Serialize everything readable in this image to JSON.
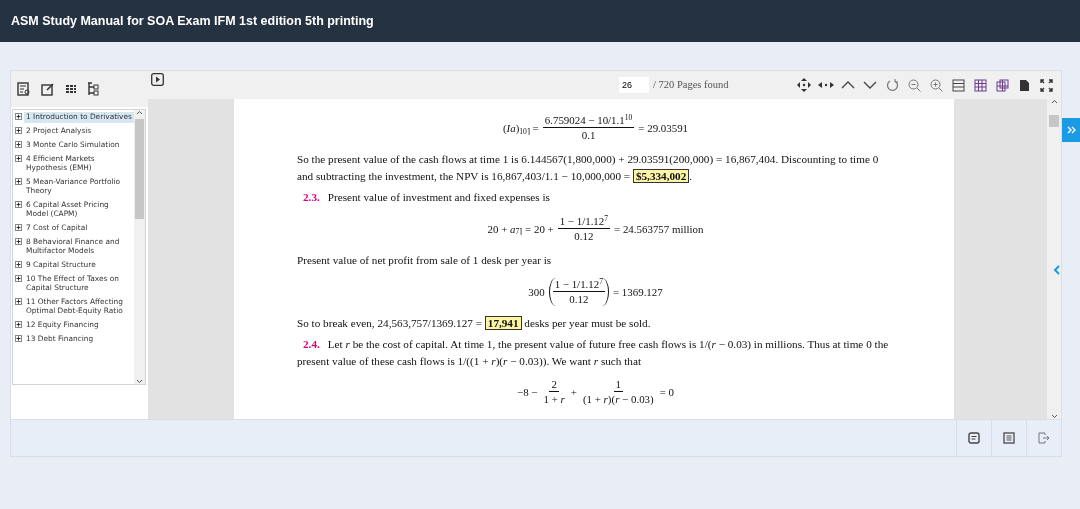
{
  "header": {
    "title": "ASM Study Manual for SOA Exam IFM 1st edition 5th printing"
  },
  "toc": {
    "items": [
      {
        "label": "1 Introduction to Derivatives",
        "selected": true
      },
      {
        "label": "2 Project Analysis",
        "selected": false
      },
      {
        "label": "3 Monte Carlo Simulation",
        "selected": false
      },
      {
        "label": "4 Efficient Markets Hypothesis (EMH)",
        "selected": false
      },
      {
        "label": "5 Mean-Variance Portfolio Theory",
        "selected": false
      },
      {
        "label": "6 Capital Asset Pricing Model (CAPM)",
        "selected": false
      },
      {
        "label": "7 Cost of Capital",
        "selected": false
      },
      {
        "label": "8 Behavioral Finance and Multifactor Models",
        "selected": false
      },
      {
        "label": "9 Capital Structure",
        "selected": false
      },
      {
        "label": "10 The Effect of Taxes on Capital Structure",
        "selected": false
      },
      {
        "label": "11 Other Factors Affecting Optimal Debt-Equity Ratio",
        "selected": false
      },
      {
        "label": "12 Equity Financing",
        "selected": false
      },
      {
        "label": "13 Debt Financing",
        "selected": false
      }
    ]
  },
  "viewer": {
    "page": "26",
    "page_count": "/ 720 Pages found"
  },
  "document": {
    "blocks": [
      {
        "kind": "equation",
        "terms": [
          {
            "kind": "text",
            "text": "(*Ia*)$_{10⌉}$ ="
          },
          {
            "kind": "frac",
            "num": "6.759024 − 10/1.1$^{10}$",
            "den": "0.1",
            "parens": false
          },
          {
            "kind": "text",
            "text": "= 29.03591"
          }
        ]
      },
      {
        "kind": "paragraph",
        "text": "So the present value of the cash flows at time 1 is 6.144567(1,800,000) + 29.03591(200,000) = 16,867,404. Discounting to time 0 and subtracting the investment, the NPV is 16,867,403/1.1 − 10,000,000 =",
        "answer": "$5,334,002",
        "after": "."
      },
      {
        "kind": "numbered",
        "number": "2.3.",
        "text": "Present value of investment and fixed expenses is"
      },
      {
        "kind": "equation",
        "terms": [
          {
            "kind": "text",
            "text": "20 + *a*$_{7⌉}$ = 20 +"
          },
          {
            "kind": "frac",
            "num": "1 − 1/1.12$^{7}$",
            "den": "0.12",
            "parens": false
          },
          {
            "kind": "text",
            "text": "= 24.563757 million"
          }
        ]
      },
      {
        "kind": "paragraph",
        "text": "Present value of net profit from sale of 1 desk per year is"
      },
      {
        "kind": "equation",
        "terms": [
          {
            "kind": "text",
            "text": "300"
          },
          {
            "kind": "frac",
            "num": "1 − 1/1.12$^{7}$",
            "den": "0.12",
            "parens": true
          },
          {
            "kind": "text",
            "text": "= 1369.127"
          }
        ]
      },
      {
        "kind": "paragraph",
        "text": "So to break even, 24,563,757/1369.127 =",
        "answer": "17,941",
        "after": "desks per year must be sold."
      },
      {
        "kind": "numbered",
        "number": "2.4.",
        "text": "Let *r* be the cost of capital. At time 1, the present value of future free cash flows is 1/(*r* − 0.03) in millions. Thus at time 0 the present value of these cash flows is 1/((1 + *r*)(*r* − 0.03)). We want *r* such that"
      },
      {
        "kind": "equation",
        "terms": [
          {
            "kind": "text",
            "text": "−8 −"
          },
          {
            "kind": "frac",
            "num": "2",
            "den": "1 + *r*",
            "parens": false
          },
          {
            "kind": "text",
            "text": "+"
          },
          {
            "kind": "frac",
            "num": "1",
            "den": "(1 + *r*)(*r* − 0.03)",
            "parens": false
          },
          {
            "kind": "text",
            "text": "= 0"
          }
        ]
      }
    ]
  }
}
